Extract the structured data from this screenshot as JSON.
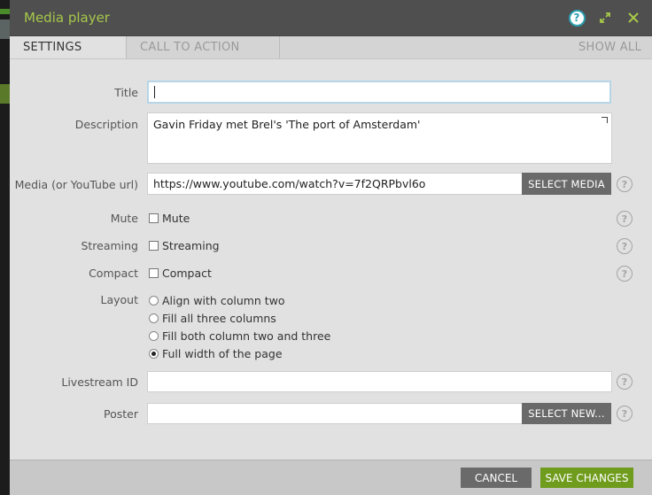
{
  "dialog": {
    "title": "Media player",
    "help_icon": "question-circle-icon",
    "maximize_icon": "maximize-icon",
    "close_icon": "close-icon"
  },
  "tabs": [
    {
      "label": "SETTINGS",
      "active": true
    },
    {
      "label": "CALL TO ACTION",
      "active": false
    },
    {
      "label": "SHOW ALL",
      "active": false
    }
  ],
  "form": {
    "title": {
      "label": "Title",
      "value": ""
    },
    "description": {
      "label": "Description",
      "value": "Gavin Friday met Brel's 'The port of Amsterdam'"
    },
    "media": {
      "label": "Media (or YouTube url)",
      "value": "https://www.youtube.com/watch?v=7f2QRPbvl6o",
      "button": "SELECT MEDIA"
    },
    "mute": {
      "label": "Mute",
      "option": "Mute",
      "checked": false
    },
    "streaming": {
      "label": "Streaming",
      "option": "Streaming",
      "checked": false
    },
    "compact": {
      "label": "Compact",
      "option": "Compact",
      "checked": false
    },
    "layout": {
      "label": "Layout",
      "options": [
        {
          "text": "Align with column two",
          "selected": false
        },
        {
          "text": "Fill all three columns",
          "selected": false
        },
        {
          "text": "Fill both column two and three",
          "selected": false
        },
        {
          "text": "Full width of the page",
          "selected": true
        }
      ]
    },
    "livestream": {
      "label": "Livestream ID",
      "value": ""
    },
    "poster": {
      "label": "Poster",
      "value": "",
      "button": "SELECT NEW..."
    },
    "help_glyph": "?"
  },
  "footer": {
    "cancel": "CANCEL",
    "save": "SAVE CHANGES"
  },
  "colors": {
    "title_green": "#a6c84a",
    "save_green": "#6f9c1d",
    "button_gray": "#6a6a6a",
    "help_blue": "#2b9fb0"
  }
}
